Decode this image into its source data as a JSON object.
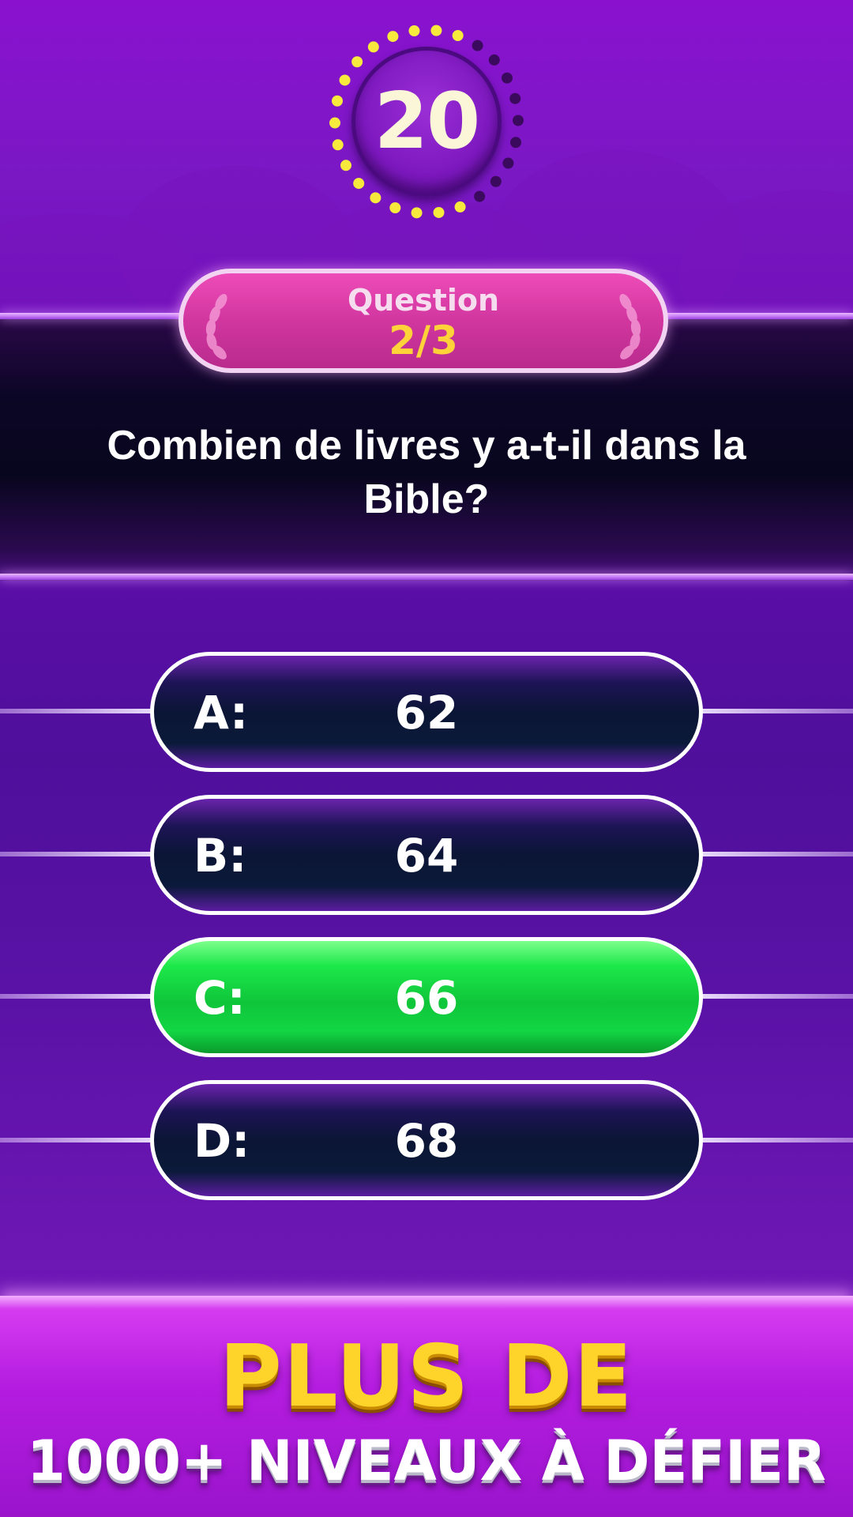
{
  "timer": {
    "value": "20",
    "total_dots": 26,
    "lit_dots": 17
  },
  "question": {
    "label": "Question",
    "counter": "2/3",
    "text": "Combien de livres y a-t-il dans la Bible?"
  },
  "answers": [
    {
      "letter": "A:",
      "value": "62",
      "state": "default"
    },
    {
      "letter": "B:",
      "value": "64",
      "state": "default"
    },
    {
      "letter": "C:",
      "value": "66",
      "state": "correct"
    },
    {
      "letter": "D:",
      "value": "68",
      "state": "default"
    }
  ],
  "promo": {
    "line1": "PLUS DE",
    "line2": "1000+ NIVEAUX À DÉFIER"
  },
  "colors": {
    "dot_lit": "#f7ea3c",
    "dot_unlit": "#3b0a5e",
    "correct": "#16d441",
    "banner": "#d93aa6",
    "counter": "#ffd23a"
  }
}
